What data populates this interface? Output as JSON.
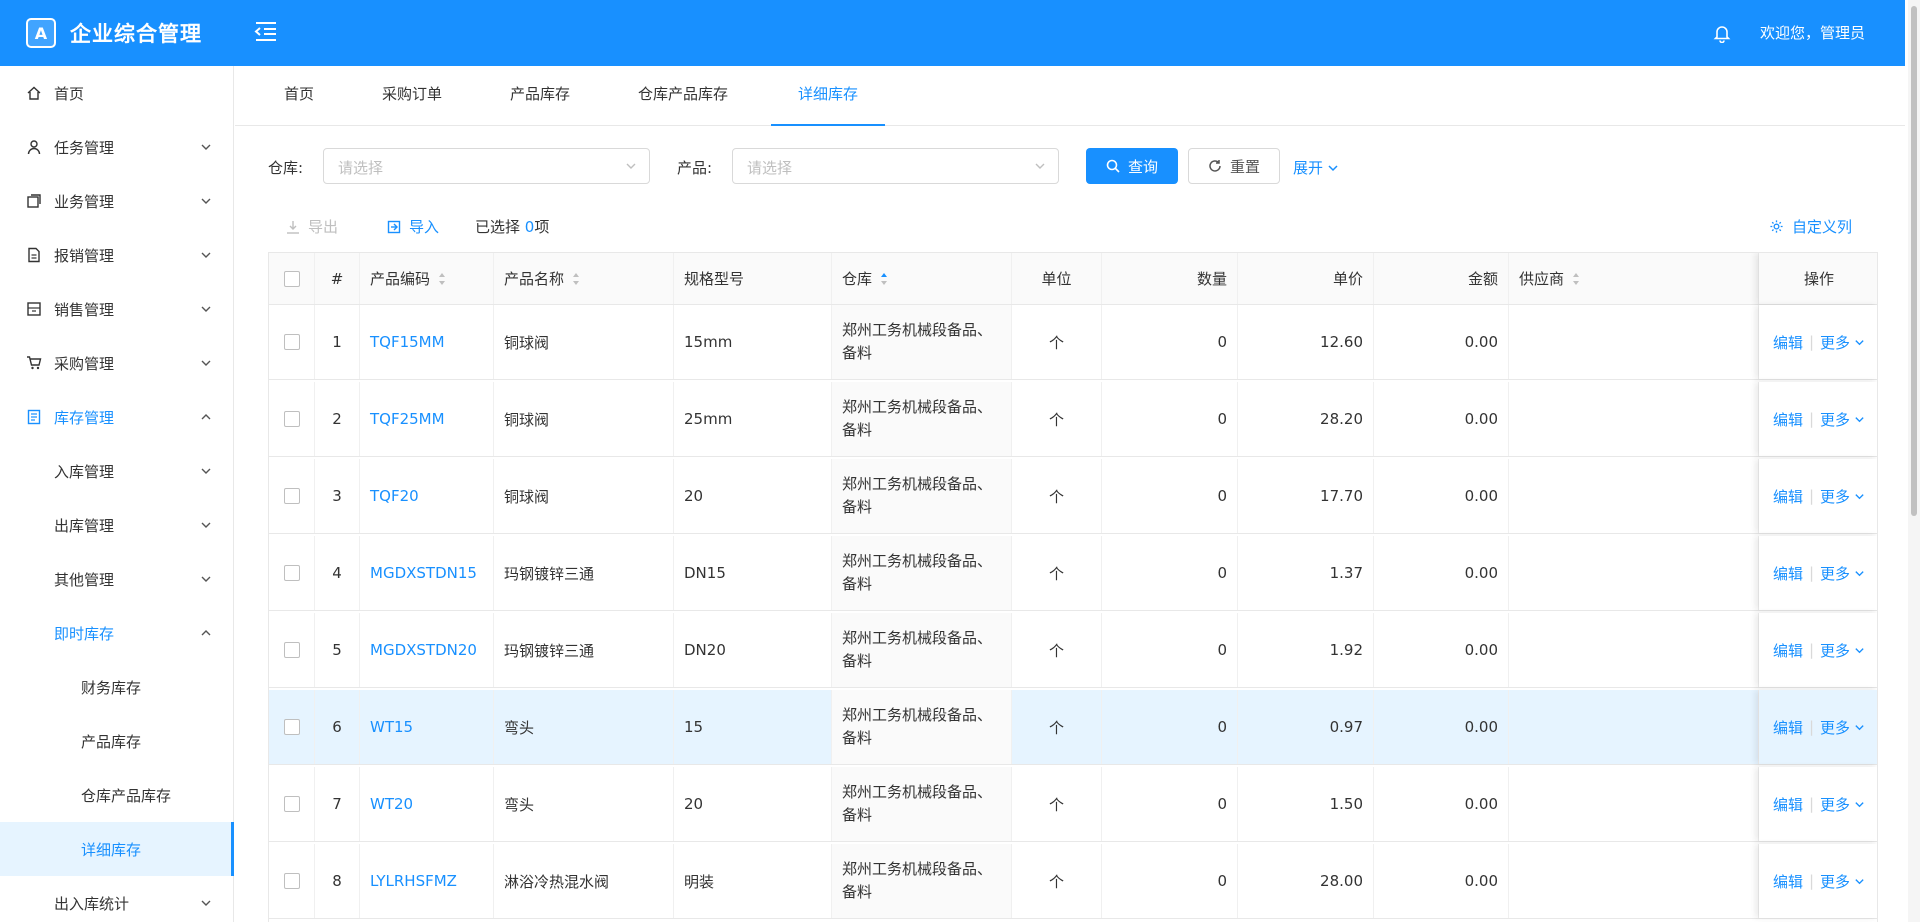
{
  "app": {
    "title": "企业综合管理",
    "welcome": "欢迎您，管理员",
    "logo_letter": "A"
  },
  "sidebar": {
    "items": [
      {
        "label": "首页",
        "icon": "home-icon"
      },
      {
        "label": "任务管理",
        "icon": "user-icon"
      },
      {
        "label": "业务管理",
        "icon": "copy-icon"
      },
      {
        "label": "报销管理",
        "icon": "file-icon"
      },
      {
        "label": "销售管理",
        "icon": "store-icon"
      },
      {
        "label": "采购管理",
        "icon": "cart-icon"
      },
      {
        "label": "库存管理",
        "icon": "book-icon"
      },
      {
        "label": "入库管理"
      },
      {
        "label": "出库管理"
      },
      {
        "label": "其他管理"
      },
      {
        "label": "即时库存"
      },
      {
        "label": "财务库存"
      },
      {
        "label": "产品库存"
      },
      {
        "label": "仓库产品库存"
      },
      {
        "label": "详细库存"
      },
      {
        "label": "出入库统计"
      }
    ]
  },
  "tabs": [
    {
      "label": "首页"
    },
    {
      "label": "采购订单"
    },
    {
      "label": "产品库存"
    },
    {
      "label": "仓库产品库存"
    },
    {
      "label": "详细库存"
    }
  ],
  "filters": {
    "warehouse_label": "仓库:",
    "warehouse_placeholder": "请选择",
    "product_label": "产品:",
    "product_placeholder": "请选择",
    "search_label": "查询",
    "reset_label": "重置",
    "expand_label": "展开"
  },
  "toolbar": {
    "export_label": "导出",
    "import_label": "导入",
    "selected_prefix": "已选择",
    "selected_count": "0",
    "selected_suffix": "项",
    "custom_cols_label": "自定义列"
  },
  "table": {
    "headers": {
      "index": "#",
      "code": "产品编码",
      "name": "产品名称",
      "spec": "规格型号",
      "warehouse": "仓库",
      "unit": "单位",
      "qty": "数量",
      "price": "单价",
      "amount": "金额",
      "supplier": "供应商",
      "ops": "操作"
    },
    "edit_label": "编辑",
    "more_label": "更多",
    "rows": [
      {
        "idx": "1",
        "code": "TQF15MM",
        "name": "铜球阀",
        "spec": "15mm",
        "warehouse": "郑州工务机械段备品、备料",
        "unit": "个",
        "qty": "0",
        "price": "12.60",
        "amount": "0.00",
        "supplier": ""
      },
      {
        "idx": "2",
        "code": "TQF25MM",
        "name": "铜球阀",
        "spec": "25mm",
        "warehouse": "郑州工务机械段备品、备料",
        "unit": "个",
        "qty": "0",
        "price": "28.20",
        "amount": "0.00",
        "supplier": ""
      },
      {
        "idx": "3",
        "code": "TQF20",
        "name": "铜球阀",
        "spec": "20",
        "warehouse": "郑州工务机械段备品、备料",
        "unit": "个",
        "qty": "0",
        "price": "17.70",
        "amount": "0.00",
        "supplier": ""
      },
      {
        "idx": "4",
        "code": "MGDXSTDN15",
        "name": "玛钢镀锌三通",
        "spec": "DN15",
        "warehouse": "郑州工务机械段备品、备料",
        "unit": "个",
        "qty": "0",
        "price": "1.37",
        "amount": "0.00",
        "supplier": ""
      },
      {
        "idx": "5",
        "code": "MGDXSTDN20",
        "name": "玛钢镀锌三通",
        "spec": "DN20",
        "warehouse": "郑州工务机械段备品、备料",
        "unit": "个",
        "qty": "0",
        "price": "1.92",
        "amount": "0.00",
        "supplier": ""
      },
      {
        "idx": "6",
        "code": "WT15",
        "name": "弯头",
        "spec": "15",
        "warehouse": "郑州工务机械段备品、备料",
        "unit": "个",
        "qty": "0",
        "price": "0.97",
        "amount": "0.00",
        "supplier": ""
      },
      {
        "idx": "7",
        "code": "WT20",
        "name": "弯头",
        "spec": "20",
        "warehouse": "郑州工务机械段备品、备料",
        "unit": "个",
        "qty": "0",
        "price": "1.50",
        "amount": "0.00",
        "supplier": ""
      },
      {
        "idx": "8",
        "code": "LYLRHSFMZ",
        "name": "淋浴冷热混水阀",
        "spec": "明装",
        "warehouse": "郑州工务机械段备品、备料",
        "unit": "个",
        "qty": "0",
        "price": "28.00",
        "amount": "0.00",
        "supplier": ""
      }
    ]
  }
}
